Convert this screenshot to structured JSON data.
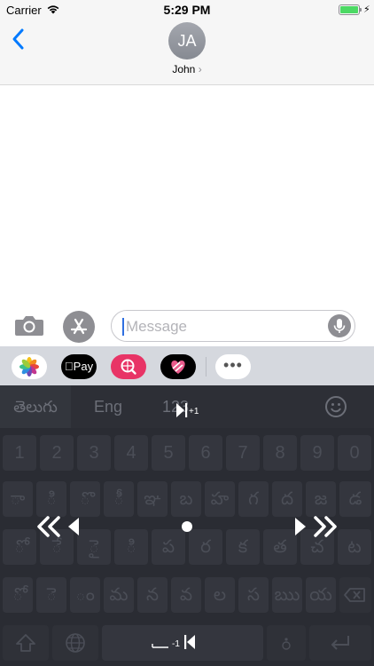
{
  "status_bar": {
    "carrier": "Carrier",
    "time": "5:29 PM",
    "battery_level": 1.0,
    "charging": true
  },
  "header": {
    "avatar_initials": "JA",
    "contact_name": "John",
    "chevron": "›"
  },
  "input": {
    "placeholder": "Message"
  },
  "app_tray": {
    "apple_pay_label": "Pay",
    "more_label": "•••"
  },
  "keyboard": {
    "tabs": {
      "telugu": "తెలుగు",
      "english": "Eng",
      "numbers": "123"
    },
    "cursor_right_hint": "+1",
    "cursor_left_hint": "-1",
    "number_row": [
      "1",
      "2",
      "3",
      "4",
      "5",
      "6",
      "7",
      "8",
      "9",
      "0"
    ],
    "row1": [
      "ా",
      "ి",
      "ొ",
      "ీ",
      "ఞ",
      "బ",
      "హ",
      "గ",
      "ద",
      "జ",
      "డ"
    ],
    "row2": [
      "ో",
      "ే",
      "ై",
      "ి",
      "ప",
      "ర",
      "క",
      "త",
      "చ",
      "ట"
    ],
    "row3": [
      "ో",
      "ె",
      "ం",
      "మ",
      "న",
      "వ",
      "ల",
      "స",
      "ఋ",
      "య"
    ],
    "bottom_row": {
      "space_hint": "-1"
    }
  },
  "colors": {
    "accent": "#007aff",
    "keyboard_bg": "#2a2c33",
    "photos_app": "#ffffff",
    "search_app": "#e83466"
  }
}
